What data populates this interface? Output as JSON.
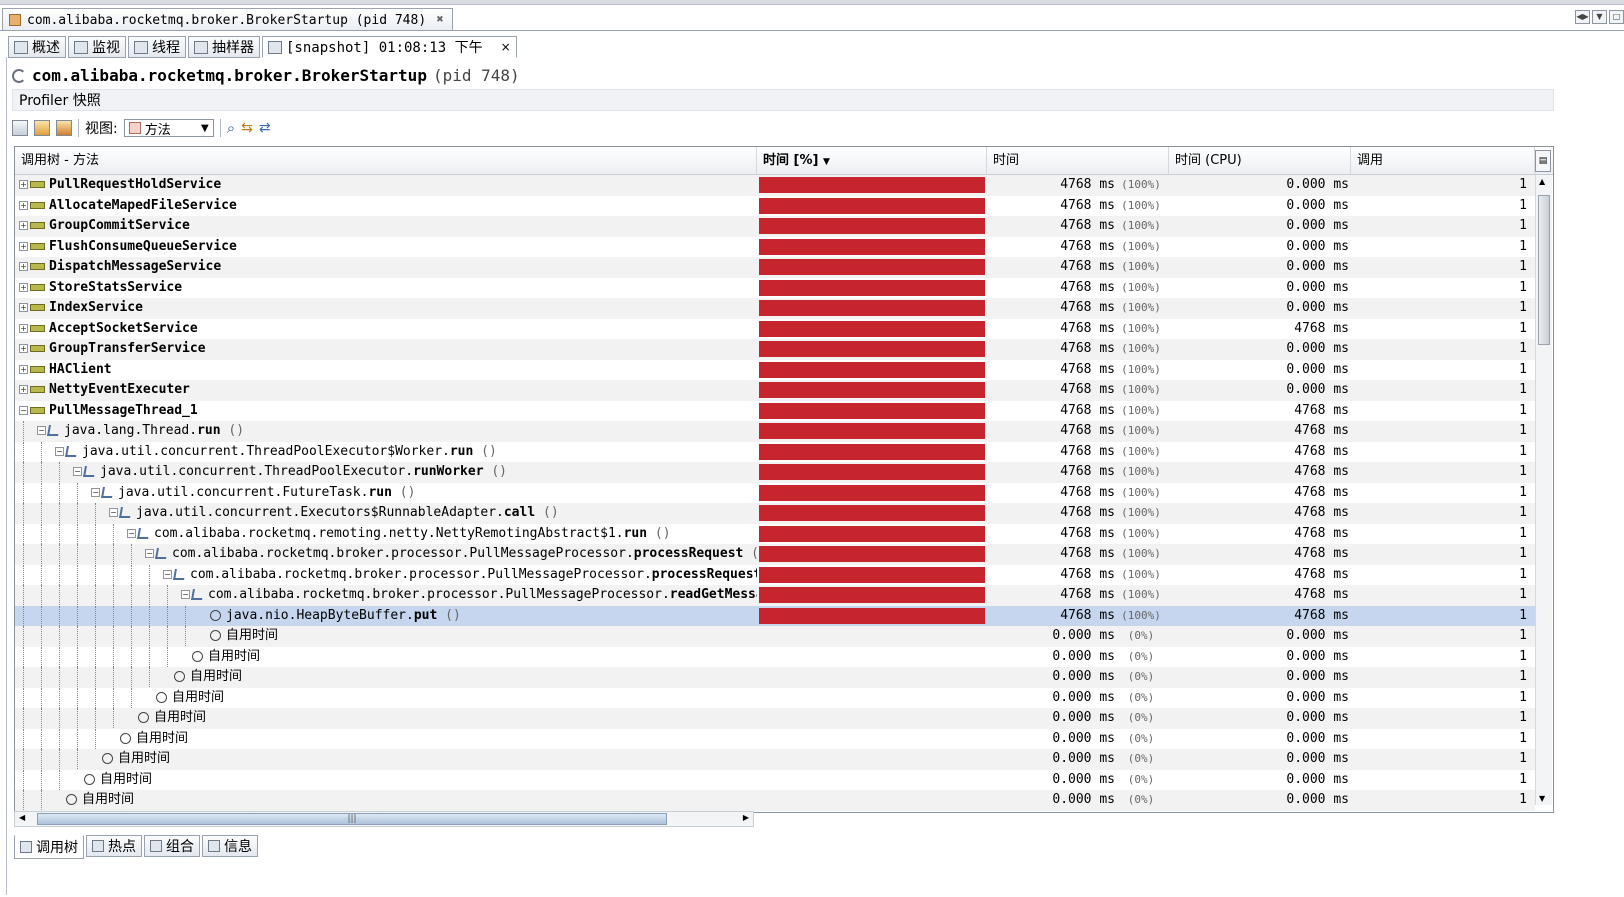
{
  "window": {
    "doc_tab_title": "com.alibaba.rocketmq.broker.BrokerStartup (pid 748)",
    "doc_tab_close": "✖"
  },
  "subtabs": [
    {
      "label": "概述",
      "icon": "overview-icon"
    },
    {
      "label": "监视",
      "icon": "monitor-icon"
    },
    {
      "label": "线程",
      "icon": "threads-icon"
    },
    {
      "label": "抽样器",
      "icon": "sampler-icon"
    },
    {
      "label": "[snapshot] 01:08:13 下午",
      "icon": "snapshot-icon",
      "close": "×"
    }
  ],
  "header": {
    "main_class": "com.alibaba.rocketmq.broker.BrokerStartup",
    "pid": "(pid 748)",
    "profiler_label": "Profiler 快照"
  },
  "toolbar": {
    "view_label": "视图:",
    "view_value": "方法"
  },
  "table": {
    "columns": {
      "tree": "调用树 - 方法",
      "time_pct": "时间 [%]",
      "time": "时间",
      "time_cpu": "时间 (CPU)",
      "calls": "调用"
    },
    "rows": [
      {
        "kind": "thread",
        "depth": 0,
        "expanded": false,
        "pkg": "",
        "method": "PullRequestHoldService",
        "suffix": "",
        "pct": 100,
        "time": "4768 ms",
        "pct_label": "(100%)",
        "cpu": "0.000 ms",
        "calls": "1"
      },
      {
        "kind": "thread",
        "depth": 0,
        "expanded": false,
        "pkg": "",
        "method": "AllocateMapedFileService",
        "suffix": "",
        "pct": 100,
        "time": "4768 ms",
        "pct_label": "(100%)",
        "cpu": "0.000 ms",
        "calls": "1"
      },
      {
        "kind": "thread",
        "depth": 0,
        "expanded": false,
        "pkg": "",
        "method": "GroupCommitService",
        "suffix": "",
        "pct": 100,
        "time": "4768 ms",
        "pct_label": "(100%)",
        "cpu": "0.000 ms",
        "calls": "1"
      },
      {
        "kind": "thread",
        "depth": 0,
        "expanded": false,
        "pkg": "",
        "method": "FlushConsumeQueueService",
        "suffix": "",
        "pct": 100,
        "time": "4768 ms",
        "pct_label": "(100%)",
        "cpu": "0.000 ms",
        "calls": "1"
      },
      {
        "kind": "thread",
        "depth": 0,
        "expanded": false,
        "pkg": "",
        "method": "DispatchMessageService",
        "suffix": "",
        "pct": 100,
        "time": "4768 ms",
        "pct_label": "(100%)",
        "cpu": "0.000 ms",
        "calls": "1"
      },
      {
        "kind": "thread",
        "depth": 0,
        "expanded": false,
        "pkg": "",
        "method": "StoreStatsService",
        "suffix": "",
        "pct": 100,
        "time": "4768 ms",
        "pct_label": "(100%)",
        "cpu": "0.000 ms",
        "calls": "1"
      },
      {
        "kind": "thread",
        "depth": 0,
        "expanded": false,
        "pkg": "",
        "method": "IndexService",
        "suffix": "",
        "pct": 100,
        "time": "4768 ms",
        "pct_label": "(100%)",
        "cpu": "0.000 ms",
        "calls": "1"
      },
      {
        "kind": "thread",
        "depth": 0,
        "expanded": false,
        "pkg": "",
        "method": "AcceptSocketService",
        "suffix": "",
        "pct": 100,
        "time": "4768 ms",
        "pct_label": "(100%)",
        "cpu": "4768 ms",
        "calls": "1"
      },
      {
        "kind": "thread",
        "depth": 0,
        "expanded": false,
        "pkg": "",
        "method": "GroupTransferService",
        "suffix": "",
        "pct": 100,
        "time": "4768 ms",
        "pct_label": "(100%)",
        "cpu": "0.000 ms",
        "calls": "1"
      },
      {
        "kind": "thread",
        "depth": 0,
        "expanded": false,
        "pkg": "",
        "method": "HAClient",
        "suffix": "",
        "pct": 100,
        "time": "4768 ms",
        "pct_label": "(100%)",
        "cpu": "0.000 ms",
        "calls": "1"
      },
      {
        "kind": "thread",
        "depth": 0,
        "expanded": false,
        "pkg": "",
        "method": "NettyEventExecuter",
        "suffix": "",
        "pct": 100,
        "time": "4768 ms",
        "pct_label": "(100%)",
        "cpu": "0.000 ms",
        "calls": "1"
      },
      {
        "kind": "thread",
        "depth": 0,
        "expanded": true,
        "pkg": "",
        "method": "PullMessageThread_1",
        "suffix": "",
        "pct": 100,
        "time": "4768 ms",
        "pct_label": "(100%)",
        "cpu": "4768 ms",
        "calls": "1"
      },
      {
        "kind": "method",
        "depth": 1,
        "expanded": true,
        "pkg": "java.lang.Thread.",
        "method": "run",
        "suffix": " ()",
        "pct": 100,
        "time": "4768 ms",
        "pct_label": "(100%)",
        "cpu": "4768 ms",
        "calls": "1"
      },
      {
        "kind": "method",
        "depth": 2,
        "expanded": true,
        "pkg": "java.util.concurrent.ThreadPoolExecutor$Worker.",
        "method": "run",
        "suffix": " ()",
        "pct": 100,
        "time": "4768 ms",
        "pct_label": "(100%)",
        "cpu": "4768 ms",
        "calls": "1"
      },
      {
        "kind": "method",
        "depth": 3,
        "expanded": true,
        "pkg": "java.util.concurrent.ThreadPoolExecutor.",
        "method": "runWorker",
        "suffix": " ()",
        "pct": 100,
        "time": "4768 ms",
        "pct_label": "(100%)",
        "cpu": "4768 ms",
        "calls": "1"
      },
      {
        "kind": "method",
        "depth": 4,
        "expanded": true,
        "pkg": "java.util.concurrent.FutureTask.",
        "method": "run",
        "suffix": " ()",
        "pct": 100,
        "time": "4768 ms",
        "pct_label": "(100%)",
        "cpu": "4768 ms",
        "calls": "1"
      },
      {
        "kind": "method",
        "depth": 5,
        "expanded": true,
        "pkg": "java.util.concurrent.Executors$RunnableAdapter.",
        "method": "call",
        "suffix": " ()",
        "pct": 100,
        "time": "4768 ms",
        "pct_label": "(100%)",
        "cpu": "4768 ms",
        "calls": "1"
      },
      {
        "kind": "method",
        "depth": 6,
        "expanded": true,
        "pkg": "com.alibaba.rocketmq.remoting.netty.NettyRemotingAbstract$1.",
        "method": "run",
        "suffix": " ()",
        "pct": 100,
        "time": "4768 ms",
        "pct_label": "(100%)",
        "cpu": "4768 ms",
        "calls": "1"
      },
      {
        "kind": "method",
        "depth": 7,
        "expanded": true,
        "pkg": "com.alibaba.rocketmq.broker.processor.PullMessageProcessor.",
        "method": "processRequest",
        "suffix": " ()",
        "pct": 100,
        "time": "4768 ms",
        "pct_label": "(100%)",
        "cpu": "4768 ms",
        "calls": "1"
      },
      {
        "kind": "method",
        "depth": 8,
        "expanded": true,
        "pkg": "com.alibaba.rocketmq.broker.processor.PullMessageProcessor.",
        "method": "processRequest",
        "suffix": "",
        "pct": 100,
        "time": "4768 ms",
        "pct_label": "(100%)",
        "cpu": "4768 ms",
        "calls": "1"
      },
      {
        "kind": "method",
        "depth": 9,
        "expanded": true,
        "pkg": "com.alibaba.rocketmq.broker.processor.PullMessageProcessor.",
        "method": "readGetMessag",
        "suffix": "",
        "pct": 100,
        "time": "4768 ms",
        "pct_label": "(100%)",
        "cpu": "4768 ms",
        "calls": "1"
      },
      {
        "kind": "leaf",
        "depth": 10,
        "expanded": false,
        "pkg": "java.nio.HeapByteBuffer.",
        "method": "put",
        "suffix": " ()",
        "pct": 100,
        "time": "4768 ms",
        "pct_label": "(100%)",
        "cpu": "4768 ms",
        "calls": "1",
        "selected": true
      },
      {
        "kind": "self",
        "depth": 10,
        "expanded": false,
        "pkg": "",
        "method": "自用时间",
        "suffix": "",
        "pct": 0,
        "time": "0.000 ms",
        "pct_label": "(0%)",
        "cpu": "0.000 ms",
        "calls": "1"
      },
      {
        "kind": "self",
        "depth": 9,
        "expanded": false,
        "pkg": "",
        "method": "自用时间",
        "suffix": "",
        "pct": 0,
        "time": "0.000 ms",
        "pct_label": "(0%)",
        "cpu": "0.000 ms",
        "calls": "1"
      },
      {
        "kind": "self",
        "depth": 8,
        "expanded": false,
        "pkg": "",
        "method": "自用时间",
        "suffix": "",
        "pct": 0,
        "time": "0.000 ms",
        "pct_label": "(0%)",
        "cpu": "0.000 ms",
        "calls": "1"
      },
      {
        "kind": "self",
        "depth": 7,
        "expanded": false,
        "pkg": "",
        "method": "自用时间",
        "suffix": "",
        "pct": 0,
        "time": "0.000 ms",
        "pct_label": "(0%)",
        "cpu": "0.000 ms",
        "calls": "1"
      },
      {
        "kind": "self",
        "depth": 6,
        "expanded": false,
        "pkg": "",
        "method": "自用时间",
        "suffix": "",
        "pct": 0,
        "time": "0.000 ms",
        "pct_label": "(0%)",
        "cpu": "0.000 ms",
        "calls": "1"
      },
      {
        "kind": "self",
        "depth": 5,
        "expanded": false,
        "pkg": "",
        "method": "自用时间",
        "suffix": "",
        "pct": 0,
        "time": "0.000 ms",
        "pct_label": "(0%)",
        "cpu": "0.000 ms",
        "calls": "1"
      },
      {
        "kind": "self",
        "depth": 4,
        "expanded": false,
        "pkg": "",
        "method": "自用时间",
        "suffix": "",
        "pct": 0,
        "time": "0.000 ms",
        "pct_label": "(0%)",
        "cpu": "0.000 ms",
        "calls": "1"
      },
      {
        "kind": "self",
        "depth": 3,
        "expanded": false,
        "pkg": "",
        "method": "自用时间",
        "suffix": "",
        "pct": 0,
        "time": "0.000 ms",
        "pct_label": "(0%)",
        "cpu": "0.000 ms",
        "calls": "1"
      },
      {
        "kind": "self",
        "depth": 2,
        "expanded": false,
        "pkg": "",
        "method": "自用时间",
        "suffix": "",
        "pct": 0,
        "time": "0.000 ms",
        "pct_label": "(0%)",
        "cpu": "0.000 ms",
        "calls": "1"
      }
    ]
  },
  "bottom_tabs": [
    {
      "label": "调用树",
      "icon": "call-tree-icon",
      "active": true
    },
    {
      "label": "热点",
      "icon": "hotspots-icon"
    },
    {
      "label": "组合",
      "icon": "combined-icon"
    },
    {
      "label": "信息",
      "icon": "info-icon"
    }
  ],
  "colors": {
    "bar": "#c6252d",
    "selection": "#c6d6ee",
    "alt_row": "#f2f2f2"
  }
}
